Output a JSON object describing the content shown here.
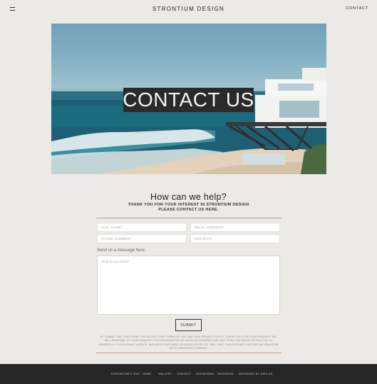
{
  "header": {
    "brand": "STRONTIUM DESIGN",
    "nav_contact": "CONTACT",
    "menu_icon": "hamburger-icon"
  },
  "hero": {
    "title": "CONTACT US"
  },
  "intro": {
    "title": "How can we help?",
    "line1": "THANK YOU FOR YOUR INTEREST IN STRONTIUM DESIGN",
    "line2": "PLEASE CONTACT US HERE."
  },
  "form": {
    "full_name_placeholder": "FULL NAME*",
    "email_placeholder": "EMAIL ADDRESS*",
    "phone_placeholder": "PHONE NUMBER*",
    "project_placeholder": "PROJECT*",
    "message_label": "Send us a message here:",
    "message_placeholder": "What do you need?",
    "submit_label": "SUBMIT",
    "disclaimer": "BY SUBMITTING THIS FORM, YOU ACCEPT OUR TERMS OF USE AND OUR PRIVACY POLICY. THANK YOU FOR YOUR ENQUIRY. WE WILL RESPOND TO YOUR REQUEST FOR INFORMATION AS SOON AS POSSIBLE AND MAY SEND THE ABOVE DETAILS ON TO GENERALLY TO RELEVANT AGENTS, BUSINESS PARTNERS OR DEVELOPERS SO THAT THEY CAN PROVIDE FURTHER INFORMATION OR TO ARRANGE A VIEWING."
  },
  "footer": {
    "copyright": "STRONTIUM © 2021",
    "home": "HOME",
    "gallery": "GALLERY",
    "contact": "CONTACT",
    "instagram": "INSTAGRAM",
    "facebook": "FACEBOOK",
    "credit": "DESIGNED BY DEPLUS"
  },
  "colors": {
    "background": "#ebeae6",
    "footer": "#252625",
    "accent_rule": "#c89c7c",
    "hero_title_bg": "#2a2a2a"
  }
}
